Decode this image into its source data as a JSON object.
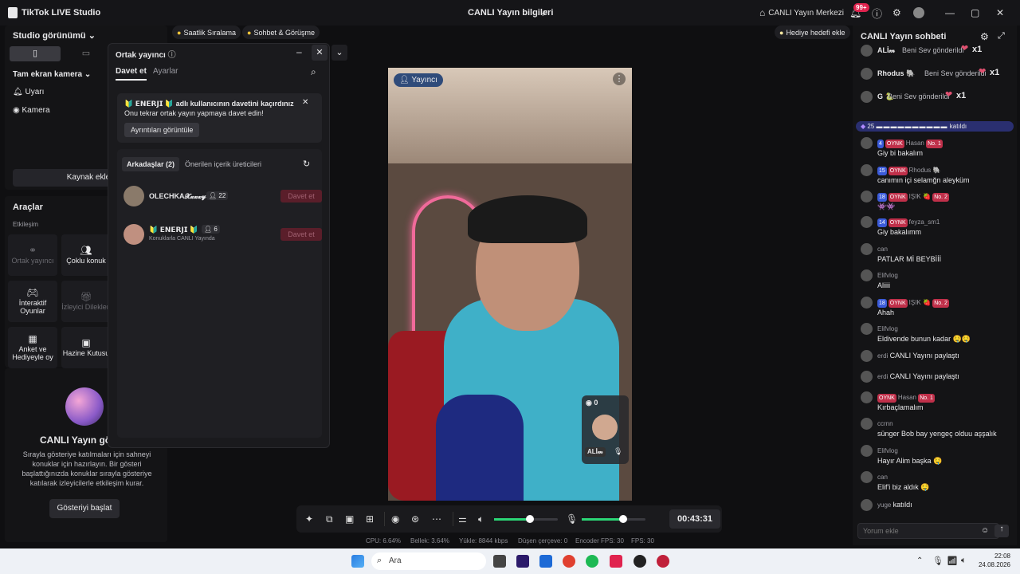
{
  "app": {
    "title": "TikTok LIVE Studio",
    "center_title": "CANLI Yayın bilgileri",
    "live_center": "CANLI Yayın Merkezi",
    "notif_badge": "99+"
  },
  "left": {
    "studio_view": "Studio görünümü",
    "fullscreen_camera": "Tam ekran kamera",
    "source1": "Uyarı",
    "source2": "Kamera",
    "add_source": "Kaynak ekle"
  },
  "tools": {
    "title": "Araçlar",
    "section": "Etkileşim",
    "items": [
      "Ortak yayıncı",
      "Çoklu konuk",
      "İnteraktif Oyunlar",
      "İzleyici Dilekleri",
      "Anket ve Hediyeyle oy",
      "Hazine Kutusu"
    ]
  },
  "show": {
    "title": "CANLI Yayın göst",
    "desc": "Sırayla gösteriye katılmaları için sahneyi konuklar için hazırlayın. Bir gösteri başlattığınızda konuklar sırayla gösteriye katılarak izleyicilerle etkileşim kurar.",
    "start_button": "Gösteriyi başlat"
  },
  "topbar": {
    "pill1": "Saatlik Sıralama",
    "pill2": "Sohbet & Görüşme",
    "gift_goal": "Hediye hedefi ekle"
  },
  "modal": {
    "title": "Ortak yayıncı",
    "tab_invite": "Davet et",
    "tab_settings": "Ayarlar",
    "notice_line1": "🔰 𝗘𝗡𝗘𝗥𝗝𝗜 🔰 adlı kullanıcının davetini kaçırdınız",
    "notice_line2": "Onu tekrar ortak yayın yapmaya davet edin!",
    "notice_button": "Ayrıntıları görüntüle",
    "friends_tab": "Arkadaşlar (2)",
    "suggested_tab": "Önerilen içerik üreticileri",
    "users": [
      {
        "name": "OLECHKA𝓧𝔁𝔁𝔁𝔂",
        "count": "22",
        "sub": "",
        "button": "Davet et"
      },
      {
        "name": "🔰 𝗘𝗡𝗘𝗥𝗝𝗜 🔰",
        "count": "6",
        "sub": "Konuklarla CANLI Yayında",
        "button": "Davet et"
      }
    ]
  },
  "video": {
    "host_label": "Yayıncı",
    "guest_count": "0",
    "guest_name": "ALİ𝓂"
  },
  "controls": {
    "timer": "00:43:31"
  },
  "status": {
    "cpu": "CPU:  6.64%",
    "mem": "Bellek:  3.64%",
    "upload": "Yükle:  8844 kbps",
    "dropped": "Düşen çerçeve:  0",
    "encoder": "Encoder FPS:  30",
    "fps": "FPS:  30"
  },
  "chat": {
    "title": "CANLI Yayın sohbeti",
    "gifts": [
      {
        "name": "ALİ𝓂",
        "text": "Beni Sev gönderildi",
        "mult": "x1"
      },
      {
        "name": "Rhodus 🐘",
        "text": "Beni Sev gönderildi",
        "mult": "x1"
      },
      {
        "name": "G 🐍",
        "text": "Beni Sev gönderildi",
        "mult": "x1"
      }
    ],
    "join_banner": {
      "level": "25",
      "text": "katıldı"
    },
    "messages": [
      {
        "name": "Hasan",
        "level": "4",
        "badge": "OYNK",
        "rank": "No. 1",
        "text": "Giy bi bakalım"
      },
      {
        "name": "Rhodus 🐘",
        "level": "15",
        "badge": "OYNK",
        "rank": "",
        "text": "canımın içi selamğn aleyküm"
      },
      {
        "name": "IŞIK 🍓",
        "level": "18",
        "badge": "OYNK",
        "rank": "No. 2",
        "text": "👾👾"
      },
      {
        "name": "feyza_sm1",
        "level": "14",
        "badge": "OYNK",
        "rank": "",
        "text": "Giy bakalımm"
      },
      {
        "name": "can",
        "level": "",
        "badge": "",
        "rank": "",
        "text": "PATLAR Mİ BEYBİİİ"
      },
      {
        "name": "Elifvlog",
        "level": "",
        "badge": "",
        "rank": "",
        "text": "Aliiii"
      },
      {
        "name": "IŞIK 🍓",
        "level": "18",
        "badge": "OYNK",
        "rank": "No. 2",
        "text": "Ahah"
      },
      {
        "name": "Elifvlog",
        "level": "",
        "badge": "",
        "rank": "",
        "text": "Eldivende bunun kadar 🤤🤤"
      },
      {
        "name": "erdi",
        "level": "",
        "badge": "",
        "rank": "",
        "text": "CANLI Yayını paylaştı",
        "inline": true
      },
      {
        "name": "erdi",
        "level": "",
        "badge": "",
        "rank": "",
        "text": "CANLI Yayını paylaştı",
        "inline": true
      },
      {
        "name": "Hasan",
        "level": "",
        "badge": "OYNK",
        "rank": "No. 1",
        "text": "Kırbaçlamalım"
      },
      {
        "name": "ccrnn",
        "level": "",
        "badge": "",
        "rank": "",
        "text": "sünger Bob bay yengeç olduu aşşalık"
      },
      {
        "name": "Elifvlog",
        "level": "",
        "badge": "",
        "rank": "",
        "text": "Hayır Alim başka 🤤"
      },
      {
        "name": "can",
        "level": "",
        "badge": "",
        "rank": "",
        "text": "Elif'i biz aldık 🤤"
      },
      {
        "name": "yuge",
        "level": "",
        "badge": "",
        "rank": "",
        "text": "katıldı",
        "inline": true
      }
    ],
    "input_placeholder": "Yorum ekle"
  },
  "taskbar": {
    "search": "Ara",
    "time": "22:08",
    "date": "24.08.2026"
  }
}
